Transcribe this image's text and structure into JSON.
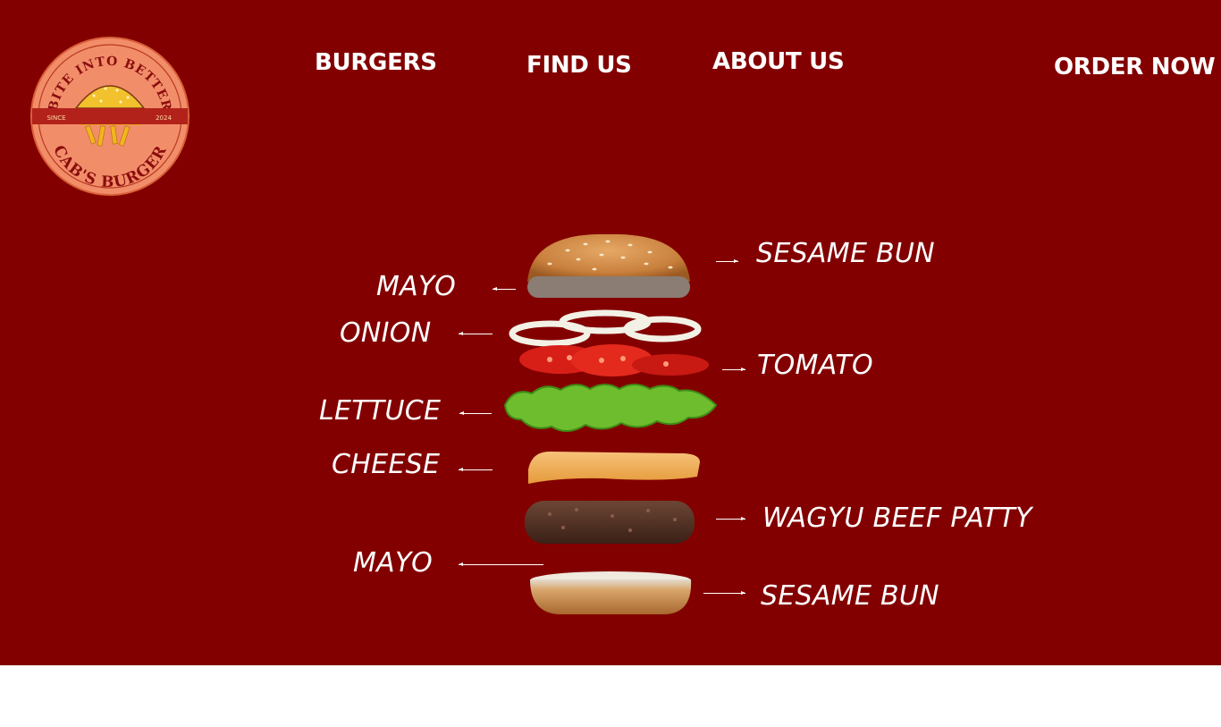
{
  "brand": {
    "logo_top_text": "BITE INTO BETTER",
    "logo_bottom_text": "CAB'S BURGER",
    "since_label": "SINCE",
    "year": "2024"
  },
  "nav": {
    "burgers": "BURGERS",
    "find_us": "FIND US",
    "about_us": "ABOUT US",
    "order_now": "ORDER NOW"
  },
  "ingredients": {
    "top_bun": "SESAME BUN",
    "mayo_top": "MAYO",
    "onion": "ONION",
    "tomato": "TOMATO",
    "lettuce": "LETTUCE",
    "cheese": "CHEESE",
    "patty": "WAGYU BEEF PATTY",
    "mayo_bottom": "MAYO",
    "bottom_bun": "SESAME BUN"
  },
  "colors": {
    "hero_background": "#830000",
    "page_background": "#ffffff",
    "logo_fill": "#f28d6a",
    "text": "#ffffff"
  }
}
